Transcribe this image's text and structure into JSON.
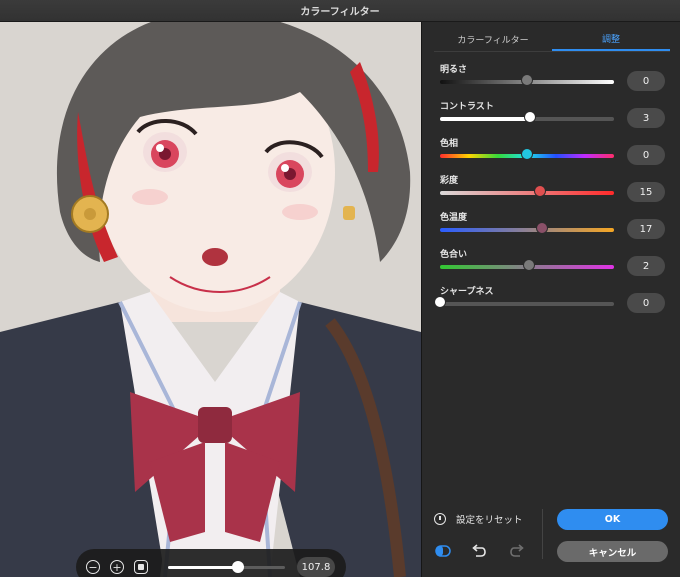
{
  "window": {
    "title": "カラーフィルター"
  },
  "tabs": [
    {
      "label": "カラーフィルター",
      "active": false
    },
    {
      "label": "調整",
      "active": true
    }
  ],
  "sliders": [
    {
      "id": "brightness",
      "label": "明るさ",
      "value": "0",
      "min": -100,
      "max": 100,
      "num": 0,
      "track": "linear-gradient(90deg,#111,#fff)"
    },
    {
      "id": "contrast",
      "label": "コントラスト",
      "value": "3",
      "min": -100,
      "max": 100,
      "num": 3,
      "track": "linear-gradient(90deg,#fff 0%,#fff 50%,#555 50%,#555 100%)"
    },
    {
      "id": "hue",
      "label": "色相",
      "value": "0",
      "min": -180,
      "max": 180,
      "num": 0,
      "track": "linear-gradient(90deg,#ff2d2d,#ffd400,#36d93a,#1ee0e6,#2450ff,#c12bff,#ff2d6a)"
    },
    {
      "id": "saturation",
      "label": "彩度",
      "value": "15",
      "min": -100,
      "max": 100,
      "num": 15,
      "track": "linear-gradient(90deg,#d9d9d9,#ff2a2a)"
    },
    {
      "id": "temperature",
      "label": "色温度",
      "value": "17",
      "min": -100,
      "max": 100,
      "num": 17,
      "track": "linear-gradient(90deg,#2a5dff,#f5a623)"
    },
    {
      "id": "tint",
      "label": "色合い",
      "value": "2",
      "min": -100,
      "max": 100,
      "num": 2,
      "track": "linear-gradient(90deg,#32c832,#e033e6)"
    },
    {
      "id": "sharpness",
      "label": "シャープネス",
      "value": "0",
      "min": 0,
      "max": 100,
      "num": 0,
      "track": "#555555"
    }
  ],
  "knob_colors": [
    "#7a7a7a",
    "#ffffff",
    "#22c7e0",
    "#e05050",
    "#8a5068",
    "#7a7a7a",
    "#ffffff"
  ],
  "zoom": {
    "value": "107.8",
    "slider_fraction": 0.6,
    "minus_glyph": "−",
    "plus_glyph": "+"
  },
  "footer": {
    "reset_label": "設定をリセット",
    "ok_label": "OK",
    "cancel_label": "キャンセル",
    "compare_icon": "compare-icon",
    "undo_icon": "undo-icon",
    "redo_icon": "redo-icon"
  },
  "colors": {
    "accent": "#2f8df0",
    "panel_bg": "#2a2a2a"
  }
}
